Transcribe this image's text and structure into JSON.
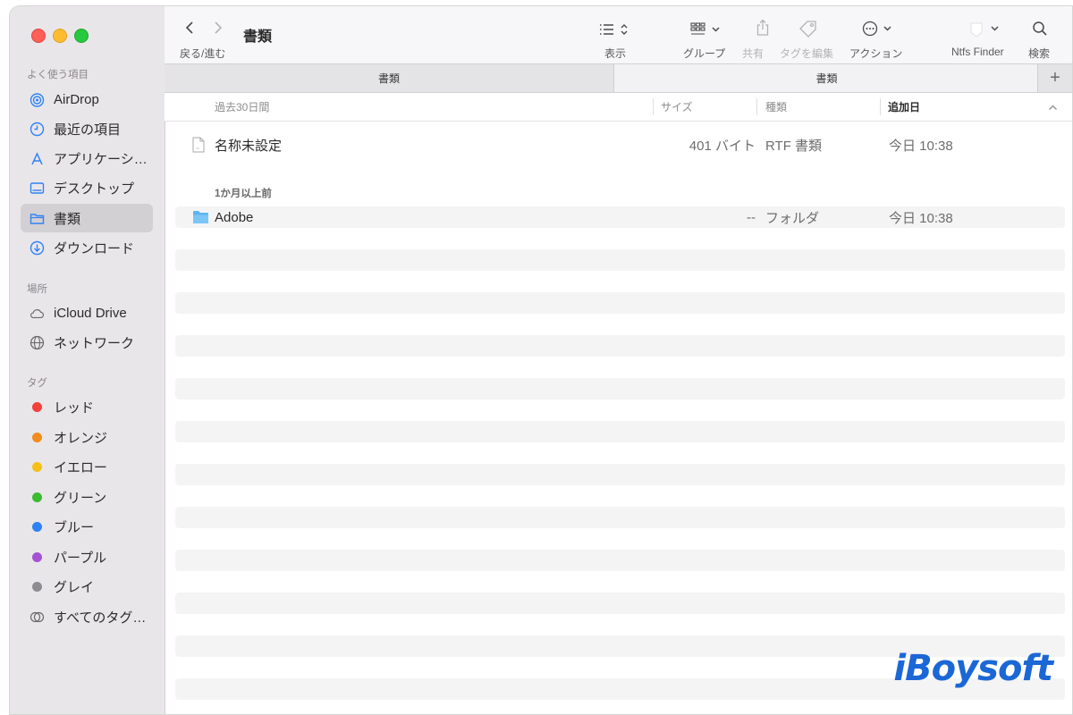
{
  "sidebar": {
    "favorites_header": "よく使う項目",
    "favorites": [
      {
        "label": "AirDrop",
        "icon": "airdrop-icon"
      },
      {
        "label": "最近の項目",
        "icon": "clock-icon"
      },
      {
        "label": "アプリケーシ…",
        "icon": "applications-icon"
      },
      {
        "label": "デスクトップ",
        "icon": "desktop-icon"
      },
      {
        "label": "書類",
        "icon": "folder-icon",
        "selected": true
      },
      {
        "label": "ダウンロード",
        "icon": "download-icon"
      }
    ],
    "locations_header": "場所",
    "locations": [
      {
        "label": "iCloud Drive",
        "icon": "cloud-icon"
      },
      {
        "label": "ネットワーク",
        "icon": "network-icon"
      }
    ],
    "tags_header": "タグ",
    "tags": [
      {
        "label": "レッド",
        "color": "#f0413c"
      },
      {
        "label": "オレンジ",
        "color": "#f28c1e"
      },
      {
        "label": "イエロー",
        "color": "#f5c017"
      },
      {
        "label": "グリーン",
        "color": "#3cbb33"
      },
      {
        "label": "ブルー",
        "color": "#2f82f4"
      },
      {
        "label": "パープル",
        "color": "#a551d6"
      },
      {
        "label": "グレイ",
        "color": "#8c8c91"
      },
      {
        "label": "すべてのタグ…",
        "icon": "all-tags-icon"
      }
    ]
  },
  "toolbar": {
    "title": "書類",
    "nav_label": "戻る/進む",
    "view_label": "表示",
    "group_label": "グループ",
    "share_label": "共有",
    "tag_edit_label": "タグを編集",
    "action_label": "アクション",
    "ntfs_label": "Ntfs Finder",
    "search_label": "検索"
  },
  "tabs": [
    {
      "label": "書類"
    },
    {
      "label": "書類"
    }
  ],
  "columns": {
    "name": "過去30日間",
    "size": "サイズ",
    "kind": "種類",
    "date_added": "追加日"
  },
  "groups": [
    {
      "header": "",
      "rows": [
        {
          "name": "名称未設定",
          "size": "401 バイト",
          "kind": "RTF 書類",
          "date": "今日 10:38",
          "icon": "document-icon"
        }
      ]
    },
    {
      "header": "1か月以上前",
      "rows": [
        {
          "name": "Adobe",
          "size": "--",
          "kind": "フォルダ",
          "date": "今日 10:38",
          "icon": "blue-folder-icon"
        }
      ]
    }
  ],
  "watermark": "iBoysoft",
  "colors": {
    "accent": "#2f82f4",
    "sidebar_bg": "#e9e6ea",
    "watermark": "#1b67d6"
  }
}
